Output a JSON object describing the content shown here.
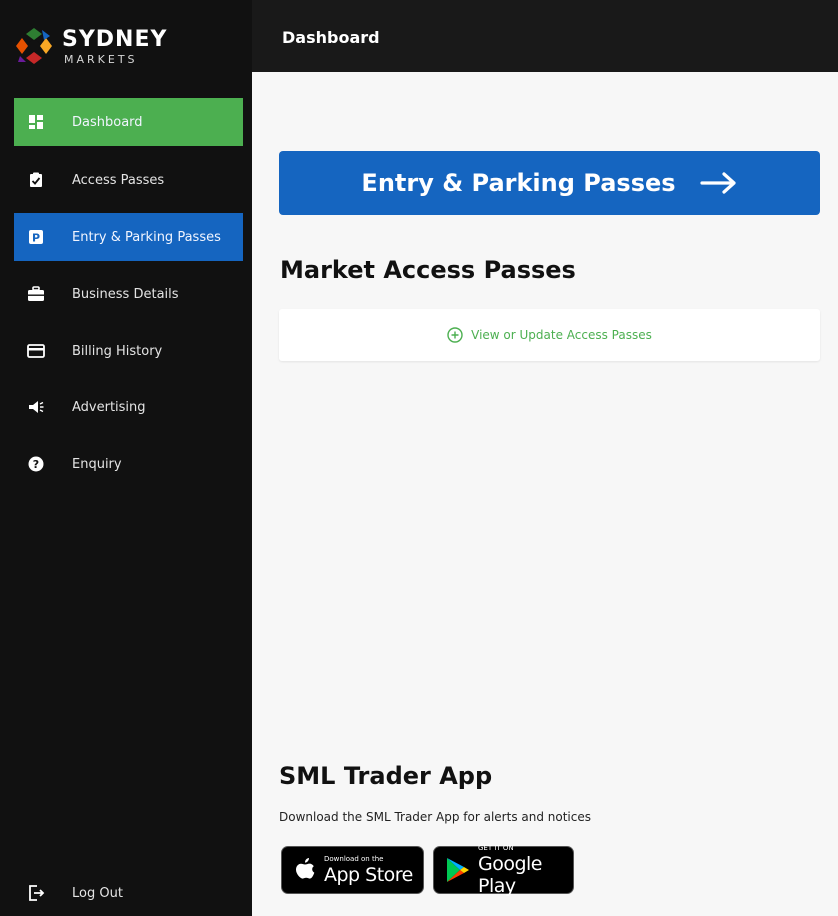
{
  "brand": {
    "name": "SYDNEY",
    "subtitle": "MARKETS"
  },
  "header": {
    "title": "Dashboard"
  },
  "sidebar": {
    "items": [
      {
        "label": "Dashboard",
        "icon": "dashboard-icon",
        "state": "active-green"
      },
      {
        "label": "Access Passes",
        "icon": "clipboard-check-icon",
        "state": "default"
      },
      {
        "label": "Entry & Parking Passes",
        "icon": "parking-icon",
        "state": "active-blue"
      },
      {
        "label": "Business Details",
        "icon": "briefcase-icon",
        "state": "default"
      },
      {
        "label": "Billing History",
        "icon": "credit-card-icon",
        "state": "default"
      },
      {
        "label": "Advertising",
        "icon": "megaphone-icon",
        "state": "default"
      },
      {
        "label": "Enquiry",
        "icon": "question-circle-icon",
        "state": "default"
      }
    ],
    "logout": {
      "label": "Log Out",
      "icon": "logout-icon"
    }
  },
  "main": {
    "entry_button": {
      "label": "Entry & Parking Passes",
      "icon": "arrow-right-icon"
    },
    "market_access": {
      "title": "Market Access Passes",
      "link_label": "View or Update Access Passes",
      "link_icon": "plus-circle-icon"
    },
    "trader_app": {
      "title": "SML Trader App",
      "description": "Download the SML Trader App for alerts and notices",
      "app_store": {
        "small": "Download on the",
        "big": "App Store",
        "icon": "apple-icon"
      },
      "google_play": {
        "small": "GET IT ON",
        "big": "Google Play",
        "icon": "google-play-icon"
      }
    }
  },
  "colors": {
    "sidebar_bg": "#111111",
    "topbar_bg": "#191919",
    "active_green": "#4caf50",
    "active_blue": "#1565c0",
    "main_bg": "#f7f7f7",
    "link_green": "#4caf50"
  }
}
